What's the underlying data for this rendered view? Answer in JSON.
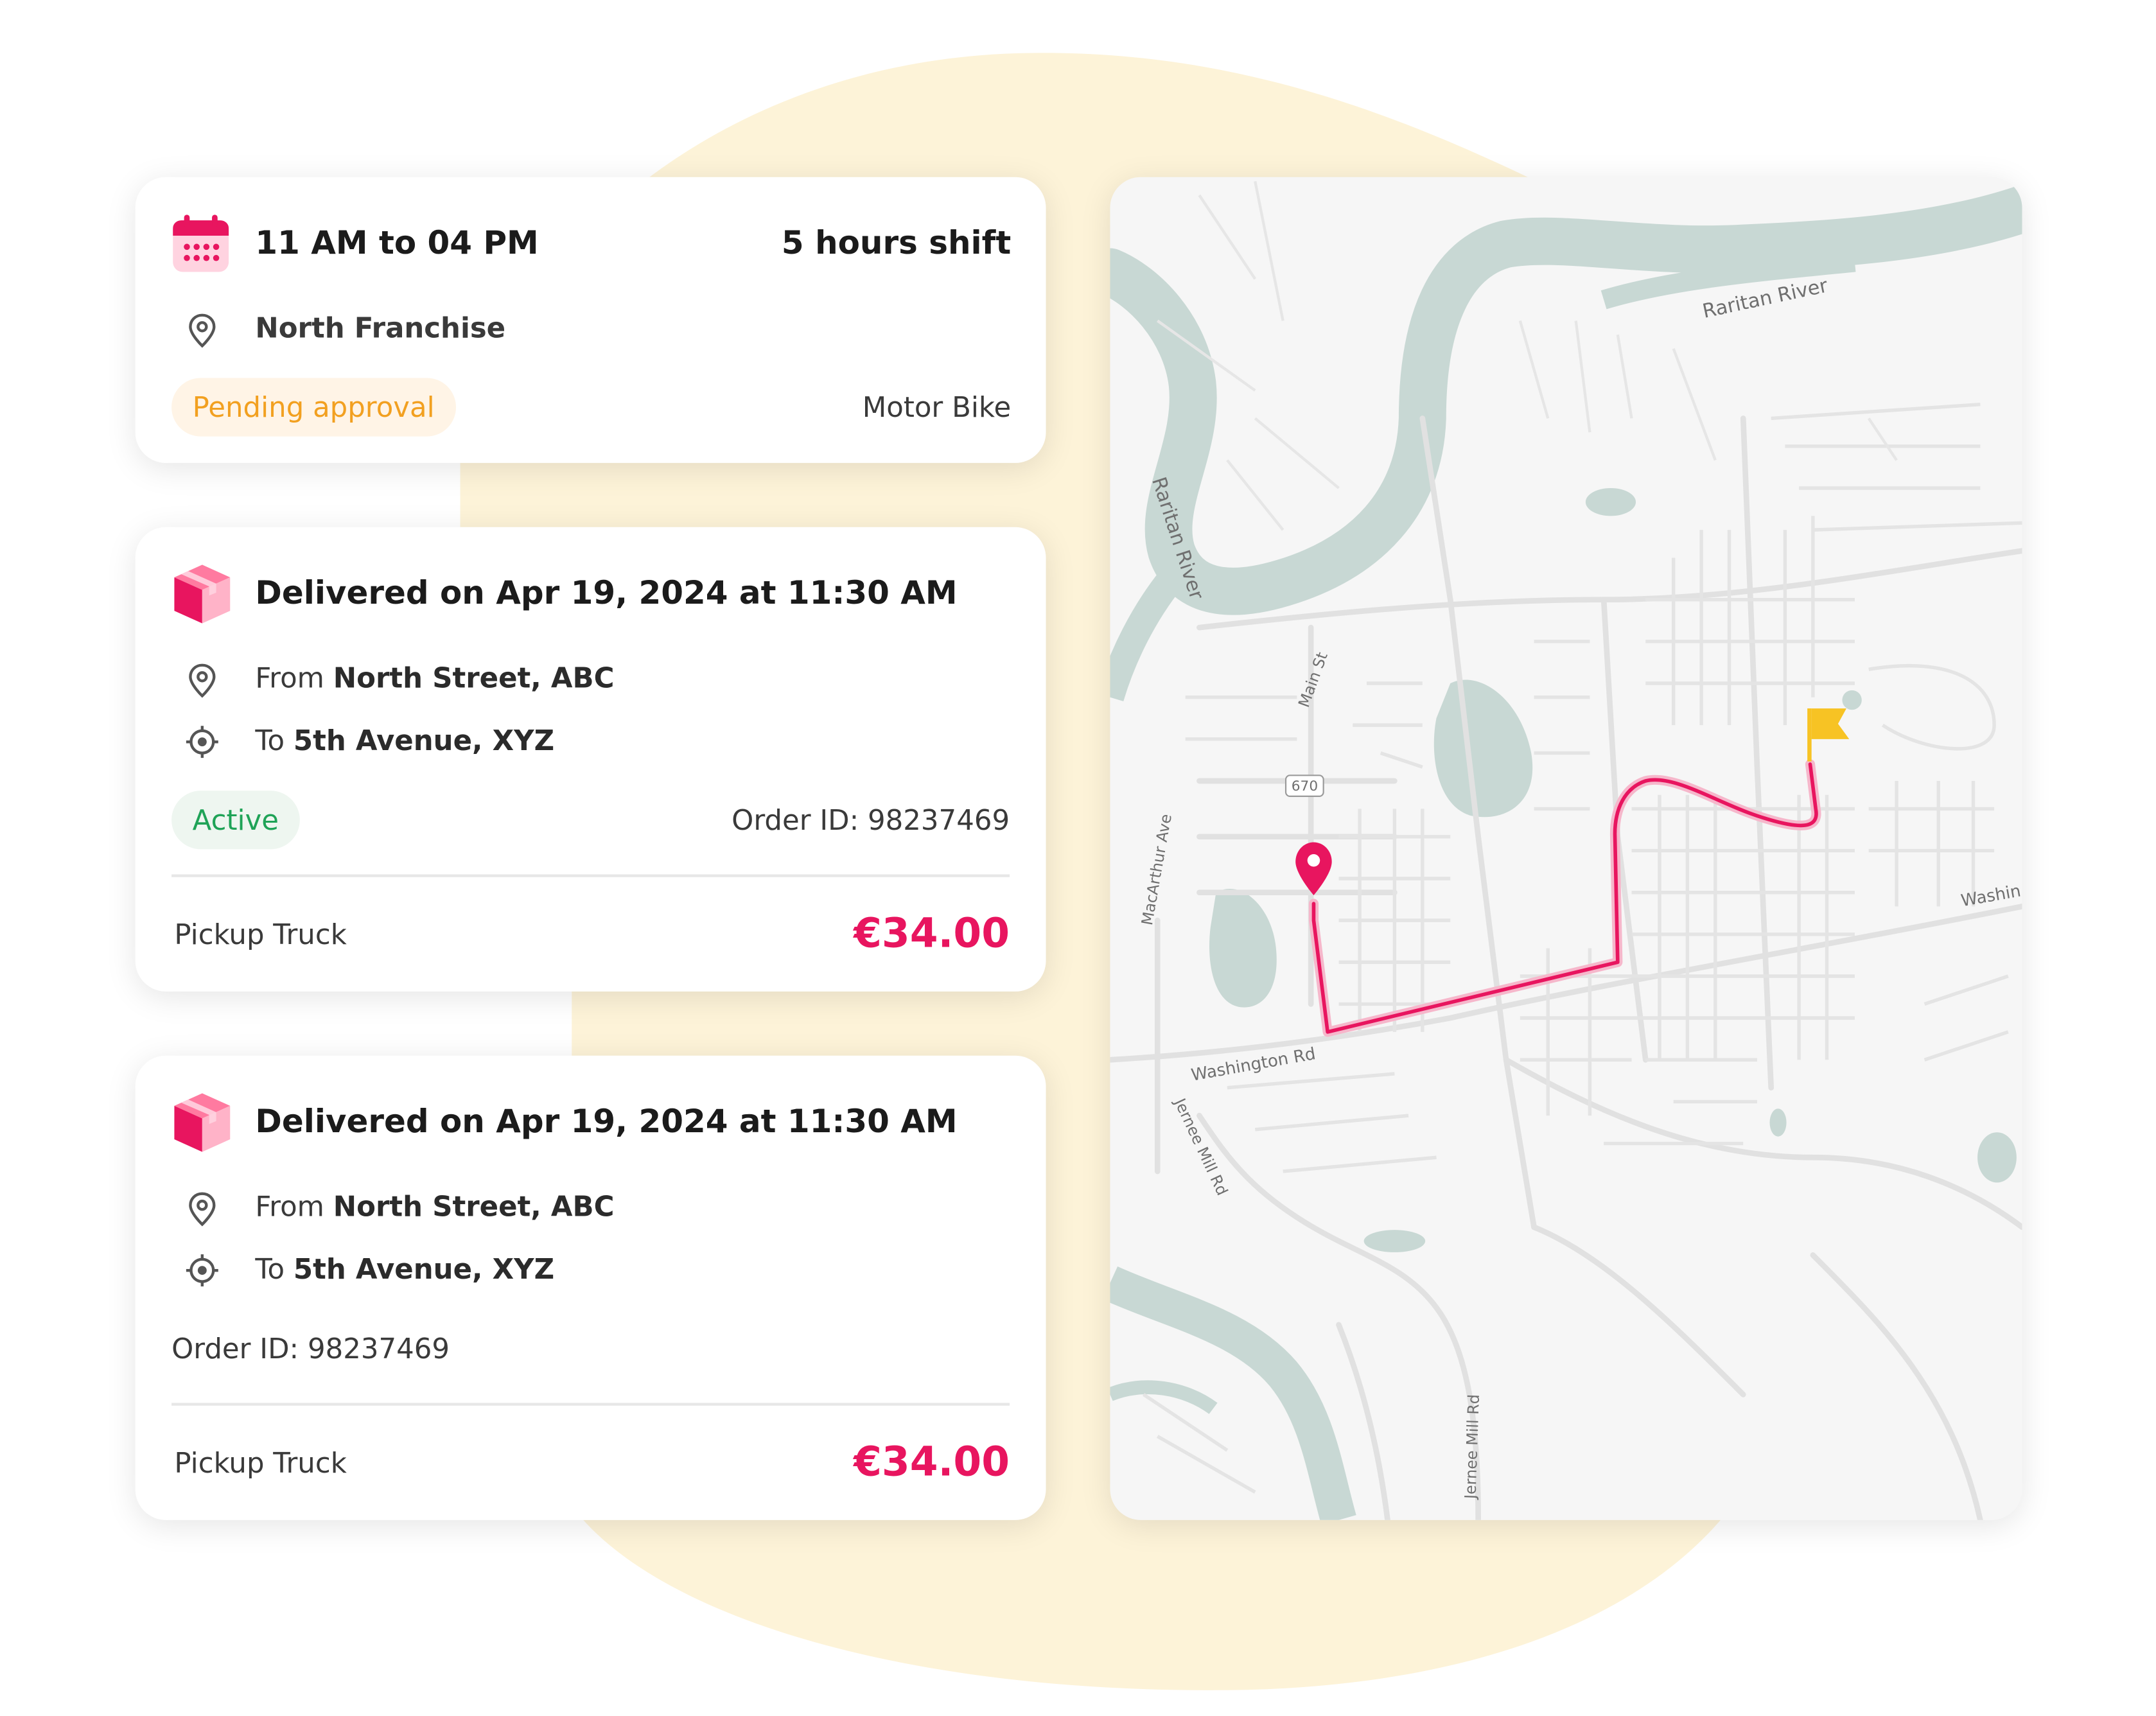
{
  "colors": {
    "accent": "#e8155f",
    "pending": "#f2a020",
    "active": "#1fa357",
    "blob": "#fdf3d8",
    "water": "#c8d8d4",
    "flag": "#f7c324"
  },
  "shift_card": {
    "time": "11 AM to 04 PM",
    "duration": "5 hours shift",
    "location": "North Franchise",
    "status": "Pending approval",
    "vehicle": "Motor Bike",
    "icons": [
      "calendar-icon",
      "location-pin-icon"
    ]
  },
  "deliveries": [
    {
      "title": "Delivered on Apr 19, 2024 at 11:30 AM",
      "from_prefix": "From",
      "from": "North Street, ABC",
      "to_prefix": "To",
      "to": "5th Avenue, XYZ",
      "status": "Active",
      "order_id": "Order ID: 98237469",
      "vehicle": "Pickup Truck",
      "price": "€34.00"
    },
    {
      "title": "Delivered on Apr 19, 2024 at 11:30 AM",
      "from_prefix": "From",
      "from": "North Street, ABC",
      "to_prefix": "To",
      "to": "5th Avenue, XYZ",
      "order_id": "Order ID: 98237469",
      "vehicle": "Pickup Truck",
      "price": "€34.00"
    }
  ],
  "map": {
    "labels": {
      "raritan_river_top": "Raritan River",
      "raritan_river_left": "Raritan River",
      "main_st": "Main St",
      "route_670": "670",
      "macarthur_ave": "MacArthur Ave",
      "washington_rd": "Washington Rd",
      "washin": "Washin",
      "jernee_mill_rd_left": "Jernee Mill Rd",
      "jernee_mill_rd_bottom": "Jernee Mill Rd"
    },
    "icons": [
      "destination-pin-icon",
      "finish-flag-icon"
    ]
  }
}
